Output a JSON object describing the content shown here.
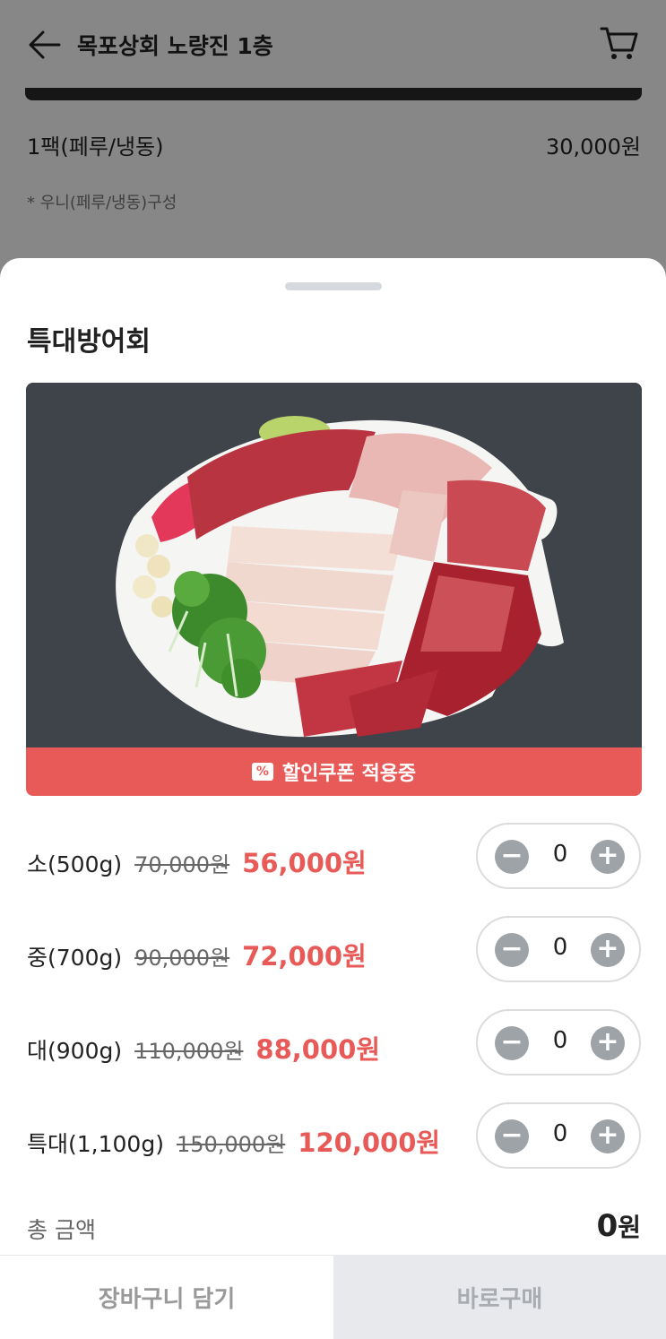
{
  "header": {
    "title": "목포상회 노량진 1층",
    "back_icon": "arrow-left-icon",
    "cart_icon": "cart-icon"
  },
  "background_item": {
    "name": "1팩(페루/냉동)",
    "price": "30,000원",
    "note": "* 우니(페루/냉동)구성"
  },
  "sheet": {
    "product_title": "특대방어회",
    "coupon_banner": "할인쿠폰 적용중",
    "coupon_icon_glyph": "%",
    "options": [
      {
        "label": "소(500g)",
        "original_price": "70,000원",
        "sale_price": "56,000원",
        "quantity": "0"
      },
      {
        "label": "중(700g)",
        "original_price": "90,000원",
        "sale_price": "72,000원",
        "quantity": "0"
      },
      {
        "label": "대(900g)",
        "original_price": "110,000원",
        "sale_price": "88,000원",
        "quantity": "0"
      },
      {
        "label": "특대(1,100g)",
        "original_price": "150,000원",
        "sale_price": "120,000원",
        "quantity": "0"
      }
    ],
    "stepper_minus": "−",
    "stepper_plus": "+",
    "total_label": "총 금액",
    "total_amount": "0",
    "total_unit": "원"
  },
  "footer": {
    "add_to_cart": "장바구니 담기",
    "buy_now": "바로구매"
  },
  "colors": {
    "accent": "#e85a58",
    "stepper_button": "#9ea3a8",
    "buy_button_bg": "#e7e9ec"
  }
}
